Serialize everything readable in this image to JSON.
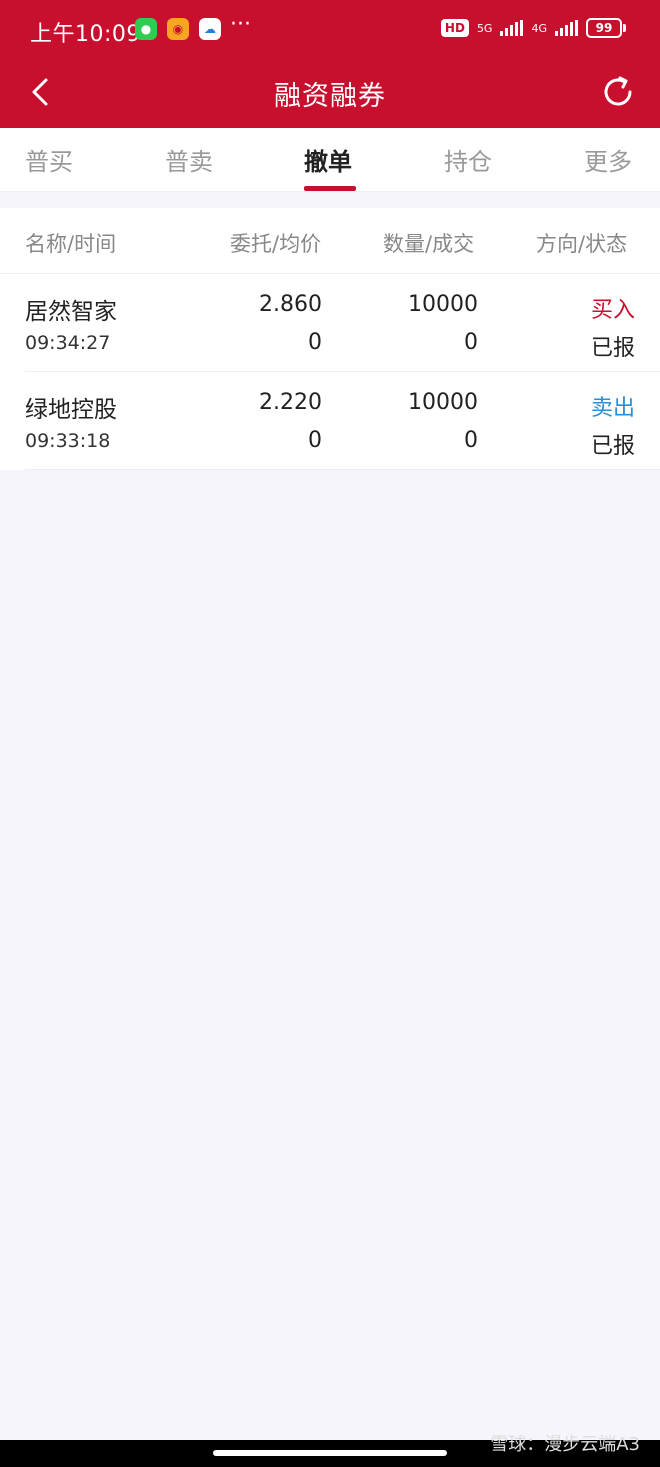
{
  "status_bar": {
    "time": "上午10:09",
    "more": "···",
    "hd": "HD",
    "net1": "5G",
    "net2": "4G",
    "battery": "99"
  },
  "header": {
    "title": "融资融券"
  },
  "tabs": [
    {
      "label": "普买"
    },
    {
      "label": "普卖"
    },
    {
      "label": "撤单"
    },
    {
      "label": "持仓"
    },
    {
      "label": "更多"
    }
  ],
  "table": {
    "headers": {
      "name_time": "名称/时间",
      "price": "委托/均价",
      "qty": "数量/成交",
      "dir_status": "方向/状态"
    },
    "rows": [
      {
        "name": "居然智家",
        "time": "09:34:27",
        "order_price": "2.860",
        "avg_price": "0",
        "quantity": "10000",
        "filled": "0",
        "direction": "买入",
        "status": "已报"
      },
      {
        "name": "绿地控股",
        "time": "09:33:18",
        "order_price": "2.220",
        "avg_price": "0",
        "quantity": "10000",
        "filled": "0",
        "direction": "卖出",
        "status": "已报"
      }
    ]
  },
  "colors": {
    "brand": "#c8102e",
    "buy": "#c8102e",
    "sell": "#2b8fd6"
  },
  "watermark": "雪球：漫步云端A3"
}
